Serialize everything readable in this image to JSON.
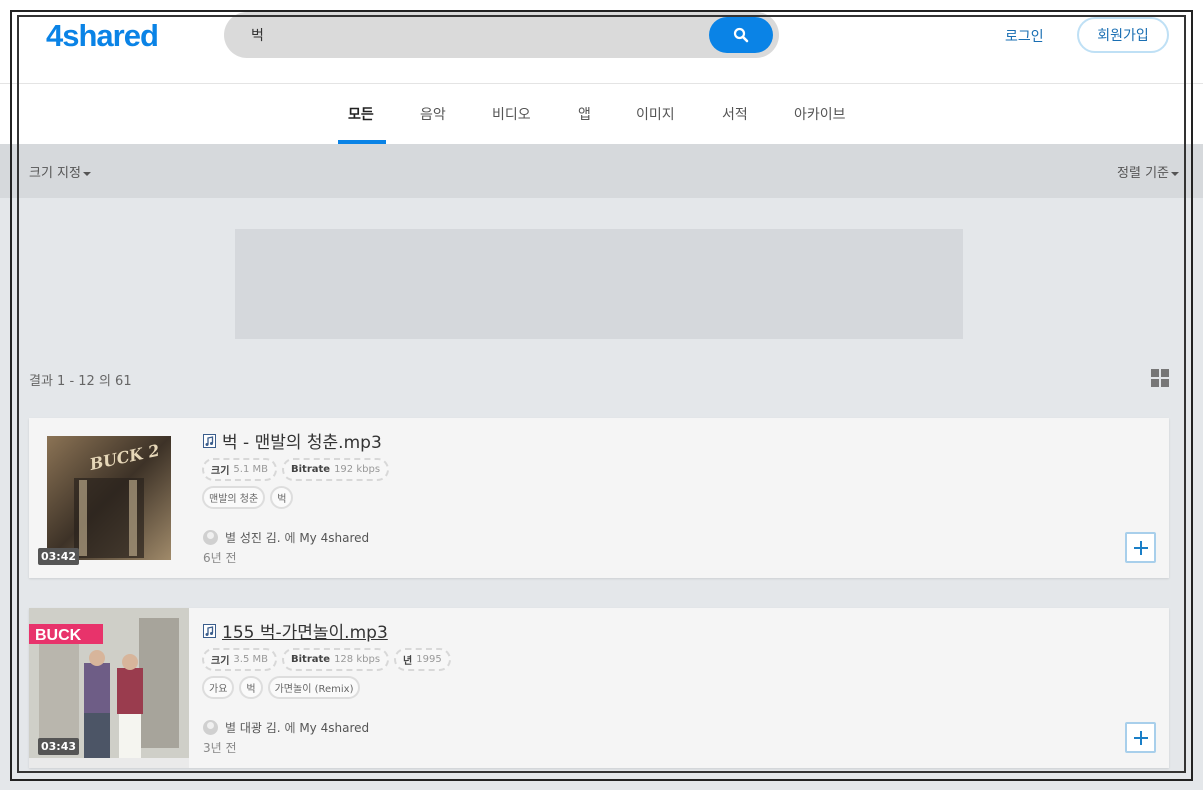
{
  "header": {
    "logo": "4shared",
    "search_value": "벅",
    "login": "로그인",
    "signup": "회원가입"
  },
  "tabs": [
    "모든",
    "음악",
    "비디오",
    "앱",
    "이미지",
    "서적",
    "아카이브"
  ],
  "filters": {
    "size": "크기 지정",
    "sort": "정렬 기준"
  },
  "results": "결과 1 - 12 의 61",
  "items": [
    {
      "title": "벅 - 맨발의 청춘.mp3",
      "duration": "03:42",
      "size_label": "크기",
      "size": "5.1 MB",
      "bitrate_label": "Bitrate",
      "bitrate": "192 kbps",
      "tags": [
        "맨발의 청춘",
        "벅"
      ],
      "owner_prefix": "별",
      "owner": "성진 김.",
      "owner_mid": "에",
      "owner_loc": "My 4shared",
      "ago": "6년 전",
      "cover_text": "BUCK 2"
    },
    {
      "title": "155 벅-가면놀이.mp3",
      "duration": "03:43",
      "size_label": "크기",
      "size": "3.5 MB",
      "bitrate_label": "Bitrate",
      "bitrate": "128 kbps",
      "year_label": "년",
      "year": "1995",
      "tags": [
        "가요",
        "벅",
        "가면놀이 (Remix)"
      ],
      "owner_prefix": "별",
      "owner": "대광 김.",
      "owner_mid": "에",
      "owner_loc": "My 4shared",
      "ago": "3년 전",
      "cover_text": "BUCK"
    }
  ],
  "colors": {
    "accent": "#0a83e6",
    "link": "#1a6fb3"
  }
}
